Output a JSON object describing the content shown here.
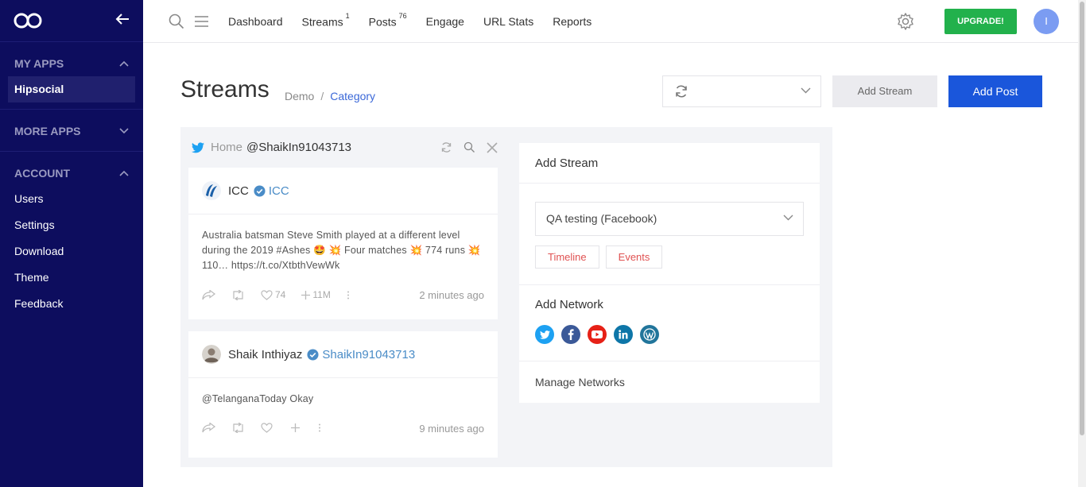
{
  "sidebar": {
    "sections": [
      {
        "title": "MY APPS",
        "expanded": true,
        "items": [
          {
            "label": "Hipsocial",
            "active": true
          }
        ]
      },
      {
        "title": "MORE APPS",
        "expanded": false,
        "items": []
      },
      {
        "title": "ACCOUNT",
        "expanded": true,
        "items": [
          {
            "label": "Users"
          },
          {
            "label": "Settings"
          },
          {
            "label": "Download"
          },
          {
            "label": "Theme"
          },
          {
            "label": "Feedback"
          }
        ]
      }
    ]
  },
  "topbar": {
    "nav": [
      {
        "label": "Dashboard",
        "badge": ""
      },
      {
        "label": "Streams",
        "badge": "1"
      },
      {
        "label": "Posts",
        "badge": "76"
      },
      {
        "label": "Engage",
        "badge": ""
      },
      {
        "label": "URL Stats",
        "badge": ""
      },
      {
        "label": "Reports",
        "badge": ""
      }
    ],
    "upgrade_label": "UPGRADE!",
    "avatar_initial": "I"
  },
  "page": {
    "title": "Streams",
    "breadcrumb": {
      "first": "Demo",
      "separator": "/",
      "second": "Category"
    },
    "add_stream_label": "Add Stream",
    "add_post_label": "Add Post"
  },
  "stream": {
    "home_label": "Home",
    "handle": "@ShaikIn91043713",
    "posts": [
      {
        "name": "ICC",
        "handle": "ICC",
        "text": "Australia batsman Steve Smith played at a different level during the 2019 #Ashes 🤩 💥 Four matches 💥 774 runs 💥 110… https://t.co/XtbthVewWk",
        "likes": "74",
        "plus": "11M",
        "time": "2 minutes ago"
      },
      {
        "name": "Shaik Inthiyaz",
        "handle": "ShaikIn91043713",
        "text": "@TelanganaToday Okay",
        "likes": "",
        "plus": "",
        "time": "9 minutes ago"
      }
    ]
  },
  "add_panel": {
    "title": "Add Stream",
    "select_value": "QA testing (Facebook)",
    "pills": [
      "Timeline",
      "Events"
    ],
    "network_title": "Add Network",
    "networks": [
      {
        "icon": "twitter-icon",
        "color": "#1da1f2"
      },
      {
        "icon": "facebook-icon",
        "color": "#3b5998"
      },
      {
        "icon": "youtube-icon",
        "color": "#e62117"
      },
      {
        "icon": "linkedin-icon",
        "color": "#0e76a8"
      },
      {
        "icon": "wordpress-icon",
        "color": "#21759b"
      }
    ],
    "manage_label": "Manage Networks"
  },
  "colors": {
    "sidebar_bg": "#0d0d5e",
    "accent_blue": "#1a56db",
    "upgrade_green": "#22b14c"
  }
}
